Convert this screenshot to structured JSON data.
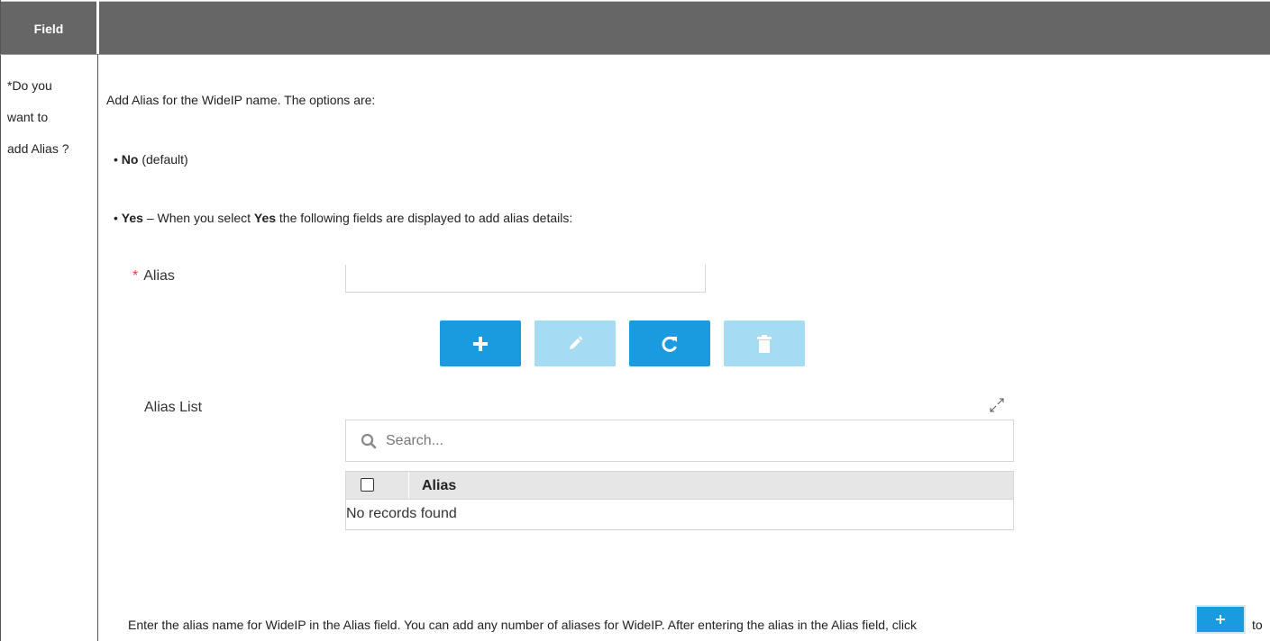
{
  "table": {
    "header_field": "Field",
    "header_description": ""
  },
  "field": {
    "label_lines": [
      "*Do you",
      "want to",
      "add Alias ?"
    ]
  },
  "description": {
    "intro": "Add Alias for the WideIP name. The options are:",
    "option_no_bold": "No",
    "option_no_rest": " (default)",
    "option_yes_bold": "Yes",
    "option_yes_mid": " – When you select ",
    "option_yes_bold2": "Yes",
    "option_yes_rest": " the following fields are displayed to add alias details:"
  },
  "form": {
    "required_mark": "*",
    "alias_label": "Alias",
    "alias_value": "",
    "buttons": [
      {
        "name": "add",
        "icon": "plus-icon",
        "enabled": true
      },
      {
        "name": "edit",
        "icon": "pencil-icon",
        "enabled": false
      },
      {
        "name": "refresh",
        "icon": "refresh-icon",
        "enabled": true
      },
      {
        "name": "delete",
        "icon": "trash-icon",
        "enabled": false
      }
    ]
  },
  "alias_list": {
    "label": "Alias List",
    "search_placeholder": "Search...",
    "column_header": "Alias",
    "empty_message": "No records found"
  },
  "footer": {
    "text": "Enter the alias name for WideIP in the Alias field. You can add any number of aliases for WideIP. After entering the alias in the Alias field, click ",
    "after_button": "to"
  },
  "colors": {
    "header_bg": "#666666",
    "button_active": "#1a9be0",
    "button_disabled": "#a5dcf3",
    "required": "#e53935"
  }
}
